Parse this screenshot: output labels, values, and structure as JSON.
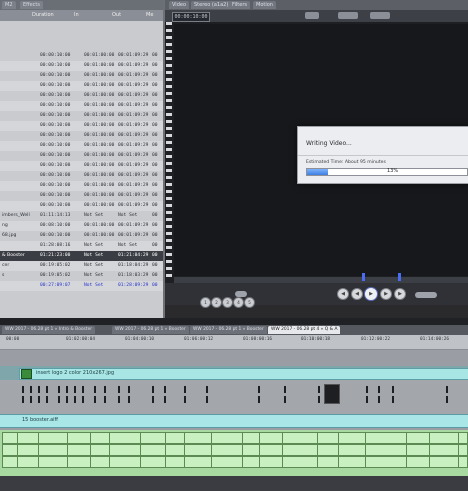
{
  "browser": {
    "tabs": [
      "M2",
      "Effects"
    ],
    "columns": [
      "Duration",
      "In",
      "Out",
      "Me"
    ],
    "names": [
      "",
      "",
      "",
      "",
      "",
      "",
      "",
      "",
      "",
      "",
      "",
      "",
      "",
      "",
      "",
      "",
      "imbers_Well",
      "ng",
      "68.jpg",
      "",
      "& Booster",
      "cer",
      "s",
      ""
    ],
    "rows": [
      [
        "00:00:10:00",
        "00:01:00:00",
        "00:01:09:29",
        "00"
      ],
      [
        "00:00:10:00",
        "00:01:00:00",
        "00:01:09:29",
        "00"
      ],
      [
        "00:00:10:00",
        "00:01:00:00",
        "00:01:09:29",
        "00"
      ],
      [
        "00:00:10:00",
        "00:01:00:00",
        "00:01:09:29",
        "00"
      ],
      [
        "00:00:10:00",
        "00:01:00:00",
        "00:01:09:29",
        "00"
      ],
      [
        "00:00:10:00",
        "00:01:00:00",
        "00:01:09:29",
        "00"
      ],
      [
        "00:00:10:00",
        "00:01:00:00",
        "00:01:09:29",
        "00"
      ],
      [
        "00:00:10:00",
        "00:01:00:00",
        "00:01:09:29",
        "00"
      ],
      [
        "00:00:10:00",
        "00:01:00:00",
        "00:01:09:29",
        "00"
      ],
      [
        "00:00:10:00",
        "00:01:00:00",
        "00:01:09:29",
        "00"
      ],
      [
        "00:00:10:00",
        "00:01:00:00",
        "00:01:09:29",
        "00"
      ],
      [
        "00:00:10:00",
        "00:01:00:00",
        "00:01:09:29",
        "00"
      ],
      [
        "00:00:10:00",
        "00:01:00:00",
        "00:01:09:29",
        "00"
      ],
      [
        "00:00:10:00",
        "00:01:00:00",
        "00:01:09:29",
        "00"
      ],
      [
        "00:00:10:00",
        "00:01:00:00",
        "00:01:09:29",
        "00"
      ],
      [
        "00:00:10:00",
        "00:01:00:00",
        "00:01:09:29",
        "00"
      ],
      [
        "01:11:14:13",
        "Not Set",
        "Not Set",
        "00"
      ],
      [
        "00:08:10:00",
        "00:01:00:00",
        "00:01:09:29",
        "00"
      ],
      [
        "00:00:10:00",
        "00:01:00:00",
        "00:01:09:29",
        "00"
      ],
      [
        "01:28:08:16",
        "Not Set",
        "Not Set",
        "00"
      ],
      [
        "01:21:23:00",
        "Not Set",
        "01:21:04:29",
        "00"
      ],
      [
        "00:19:05:02",
        "Not Set",
        "01:18:04:29",
        "00"
      ],
      [
        "00:19:05:02",
        "Not Set",
        "01:18:03:29",
        "00"
      ],
      [
        "00:27:09:07",
        "Not Set",
        "01:28:09:29",
        "00"
      ]
    ]
  },
  "viewer": {
    "tabs": [
      "Video",
      "Stereo (a1a2)",
      "Filters",
      "Motion"
    ],
    "timecode": "00:00:10:00"
  },
  "dialog": {
    "title": "Writing Video...",
    "estimate": "Estimated Time: About 95 minutes",
    "progress_label": "13%",
    "progress": 0.13
  },
  "transport": {
    "buttons": [
      "mark-in",
      "previous",
      "play",
      "next",
      "mark-out"
    ],
    "jog": [
      "1",
      "2",
      "3",
      "4",
      "5",
      "6",
      "7"
    ]
  },
  "timeline": {
    "tabs": [
      "WW 2017 - 06.28 pt 1 » Intro & Booster",
      "WW 2017 - 06.28 pt 1 » Booster",
      "WW 2017 - 06.28 pt 1 » Booster",
      "WW 2017 - 06.28 pt 4 » Q & A"
    ],
    "ruler": [
      "00:00",
      "01:02:00:04",
      "01:04:00:10",
      "01:06:00:12",
      "01:08:00:16",
      "01:10:00:18",
      "01:12:00:22",
      "01:14:00:26"
    ],
    "v2_clip": "insert logo 2 color 210x267.jpg",
    "a_clip": "15 booster.aiff"
  },
  "colors": {
    "dialog_bg": "#ecedf0",
    "progress": "#3c7fe0",
    "video_clip": "#a8e6e6",
    "audio_clip": "#c8f0c0"
  }
}
